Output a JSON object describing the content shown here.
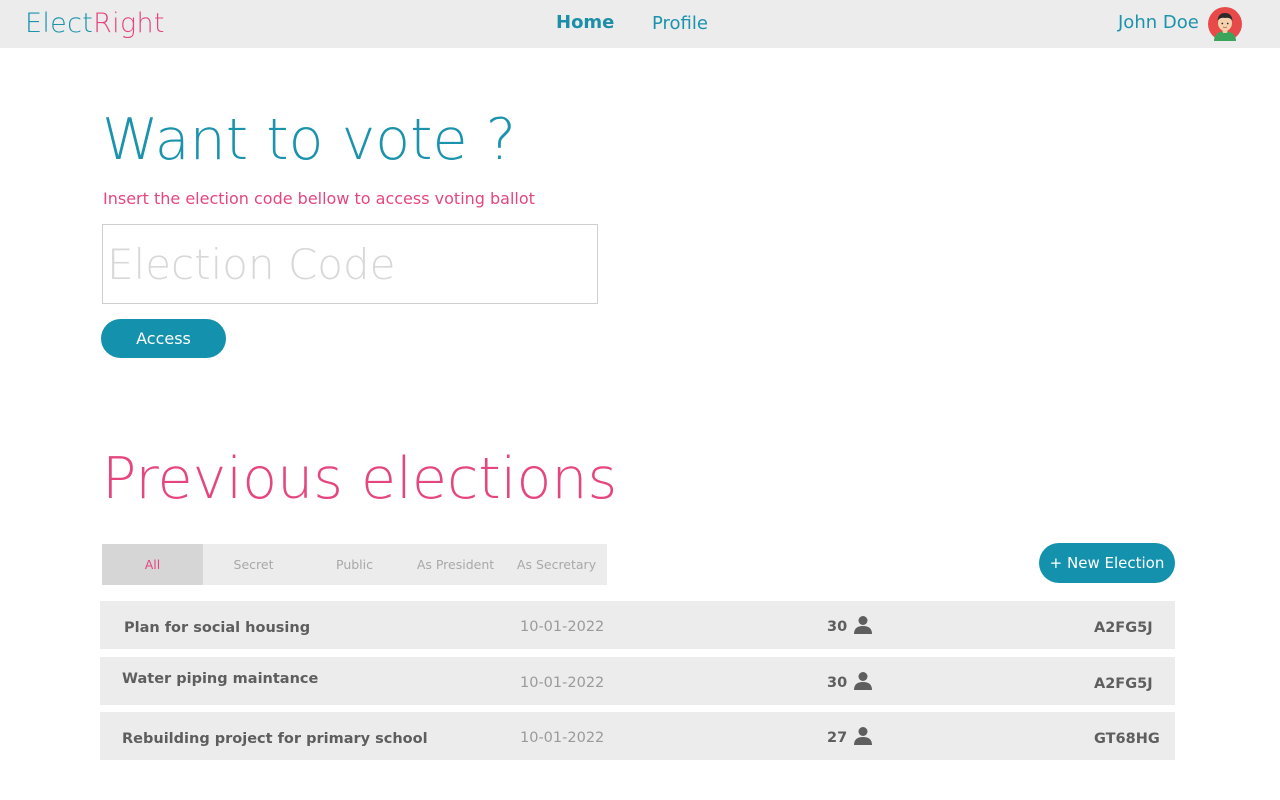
{
  "brand": {
    "part1": "Elect",
    "part2": "Right",
    "color1": "#1c93ac",
    "color2": "#e6467f"
  },
  "nav": {
    "home": "Home",
    "profile": "Profile"
  },
  "user": {
    "name": "John Doe",
    "avatar_icon": "avatar-icon"
  },
  "vote": {
    "title": "Want to vote ?",
    "subtitle": "Insert the election code bellow to access voting ballot",
    "input_placeholder": "Election Code",
    "input_value": "",
    "access_label": "Access"
  },
  "previous": {
    "title": "Previous elections",
    "filters": [
      "All",
      "Secret",
      "Public",
      "As President",
      "As Secretary"
    ],
    "active_filter": "All",
    "new_button_label": "+ New Election",
    "rows": [
      {
        "name": "Plan for social housing",
        "date": "10-01-2022",
        "count": "30",
        "code": "A2FG5J"
      },
      {
        "name": "Water piping maintance",
        "date": "10-01-2022",
        "count": "30",
        "code": "A2FG5J"
      },
      {
        "name": "Rebuilding project for primary school",
        "date": "10-01-2022",
        "count": "27",
        "code": "GT68HG"
      }
    ],
    "participants_icon": "user-icon"
  },
  "colors": {
    "accent": "#1c93ac",
    "brand_pink": "#e6467f",
    "button": "#1391ad",
    "bar": "#ececec"
  }
}
